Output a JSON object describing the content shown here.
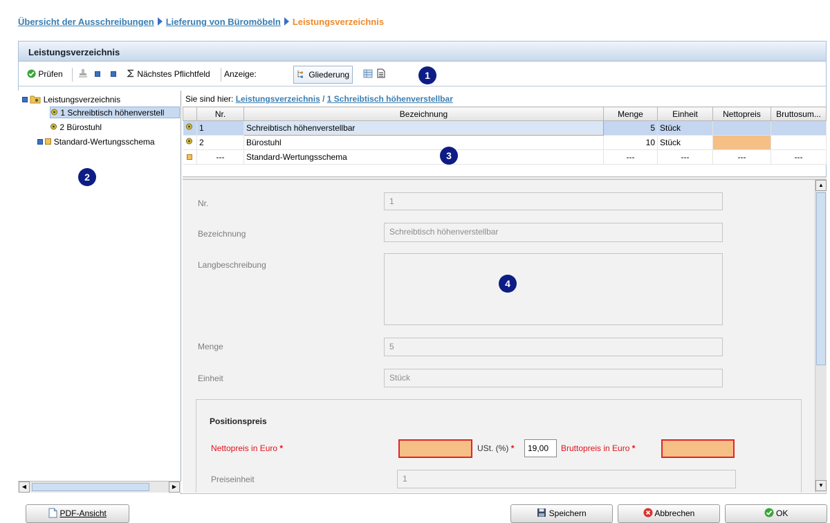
{
  "breadcrumb": {
    "link1": "Übersicht der Ausschreibungen",
    "link2": "Lieferung von Büromöbeln",
    "current": "Leistungsverzeichnis"
  },
  "panel": {
    "title": "Leistungsverzeichnis"
  },
  "toolbar": {
    "pruefen": "Prüfen",
    "naechstes": "Nächstes Pflichtfeld",
    "anzeige": "Anzeige:",
    "gliederung": "Gliederung"
  },
  "tree": {
    "root": "Leistungsverzeichnis",
    "item1": "1 Schreibtisch höhenverstell",
    "item2": "2 Bürostuhl",
    "item3": "Standard-Wertungsschema"
  },
  "location": {
    "prefix": "Sie sind hier:",
    "crumb1": "Leistungsverzeichnis",
    "sep": "/",
    "crumb2": "1 Schreibtisch höhenverstellbar"
  },
  "grid": {
    "headers": [
      "Nr.",
      "Bezeichnung",
      "Menge",
      "Einheit",
      "Nettopreis",
      "Bruttosum..."
    ],
    "rows": [
      {
        "nr": "1",
        "bez": "Schreibtisch höhenverstellbar",
        "menge": "5",
        "einheit": "Stück",
        "netto": "",
        "brutto": ""
      },
      {
        "nr": "2",
        "bez": "Bürostuhl",
        "menge": "10",
        "einheit": "Stück",
        "netto": "",
        "brutto": ""
      },
      {
        "nr": "---",
        "bez": "Standard-Wertungsschema",
        "menge": "---",
        "einheit": "---",
        "netto": "---",
        "brutto": "---"
      }
    ]
  },
  "form": {
    "nr_label": "Nr.",
    "nr_value": "1",
    "bez_label": "Bezeichnung",
    "bez_value": "Schreibtisch höhenverstellbar",
    "lang_label": "Langbeschreibung",
    "lang_value": "",
    "menge_label": "Menge",
    "menge_value": "5",
    "einheit_label": "Einheit",
    "einheit_value": "Stück",
    "pp_title": "Positionspreis",
    "netto_label": "Nettopreis in Euro",
    "ust_label": "USt. (%)",
    "ust_value": "19,00",
    "brutto_label": "Bruttopreis in Euro",
    "required_mark": "*",
    "preiseinheit_label": "Preiseinheit",
    "preiseinheit_value": "1"
  },
  "footer": {
    "pdf": "PDF-Ansicht",
    "speichern": "Speichern",
    "abbrechen": "Abbrechen",
    "ok": "OK"
  },
  "badges": [
    "1",
    "2",
    "3",
    "4"
  ],
  "colors": {
    "link": "#3a7eb2",
    "current": "#ef8a2a",
    "required": "#e0121b",
    "missing_fill": "#f5bf85",
    "selection": "#c4d6f0",
    "badge": "#0d1d85"
  }
}
